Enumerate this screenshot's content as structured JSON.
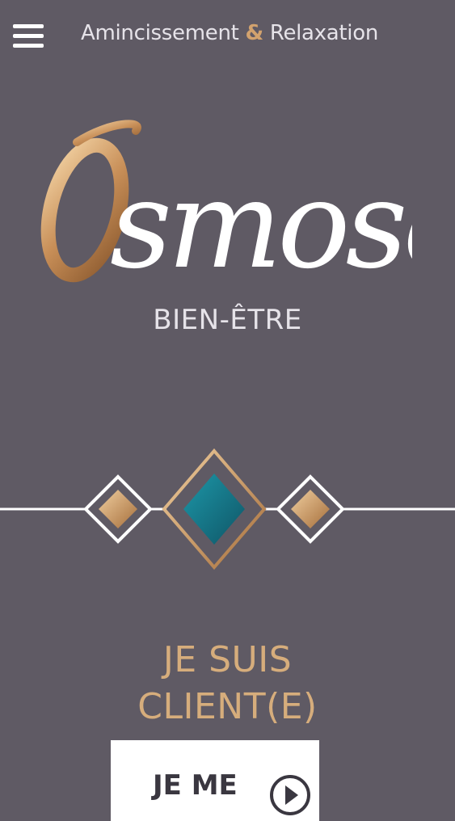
{
  "header": {
    "tagline_part1": "Amincissement",
    "tagline_amp": "&",
    "tagline_part2": "Relaxation"
  },
  "logo": {
    "text": "Osmose",
    "subtitle": "BIEN-ÊTRE"
  },
  "cta": {
    "heading_line1": "JE SUIS",
    "heading_line2": "CLIENT(E)",
    "button_label": "JE ME"
  },
  "colors": {
    "background": "#5f5a64",
    "gold": "#d2a26e",
    "teal": "#177a8d",
    "white": "#ffffff"
  },
  "icons": {
    "menu": "hamburger-menu-icon",
    "play": "play-circle-icon"
  }
}
